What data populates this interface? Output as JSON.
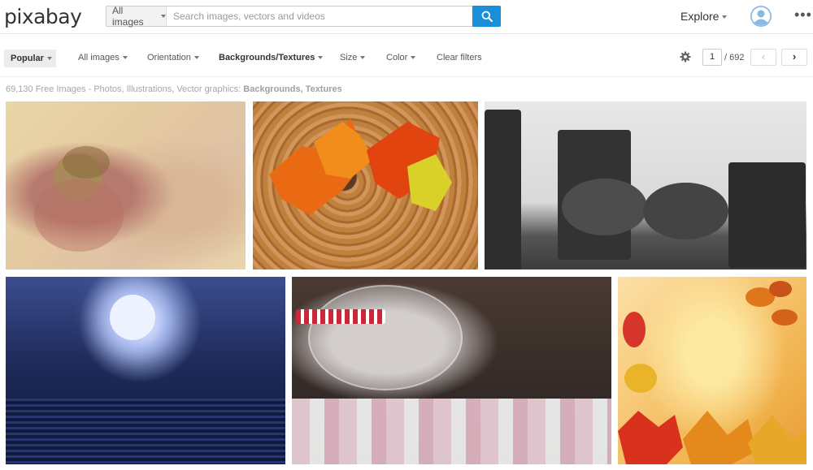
{
  "header": {
    "logo": "pixabay",
    "search_type": "All images",
    "search_placeholder": "Search images, vectors and videos",
    "explore": "Explore",
    "more": "•••"
  },
  "filters": {
    "popular": "Popular",
    "all_images": "All images",
    "orientation": "Orientation",
    "category": "Backgrounds/Textures",
    "size": "Size",
    "color": "Color",
    "clear": "Clear filters"
  },
  "pagination": {
    "current": "1",
    "total": "/ 692",
    "prev": "‹",
    "next": "›"
  },
  "summary": {
    "text": "69,130 Free Images - Photos, Illustrations, Vector graphics: ",
    "category": "Backgrounds, Textures"
  },
  "colors": {
    "accent": "#1b8ed9"
  },
  "gallery": [
    {
      "name": "music-sheet-flower-image"
    },
    {
      "name": "autumn-leaves-on-wood-image"
    },
    {
      "name": "sneakers-on-posts-image"
    },
    {
      "name": "moon-butterflies-image"
    },
    {
      "name": "marshmallow-jar-image"
    },
    {
      "name": "autumn-leaves-border-image"
    }
  ]
}
